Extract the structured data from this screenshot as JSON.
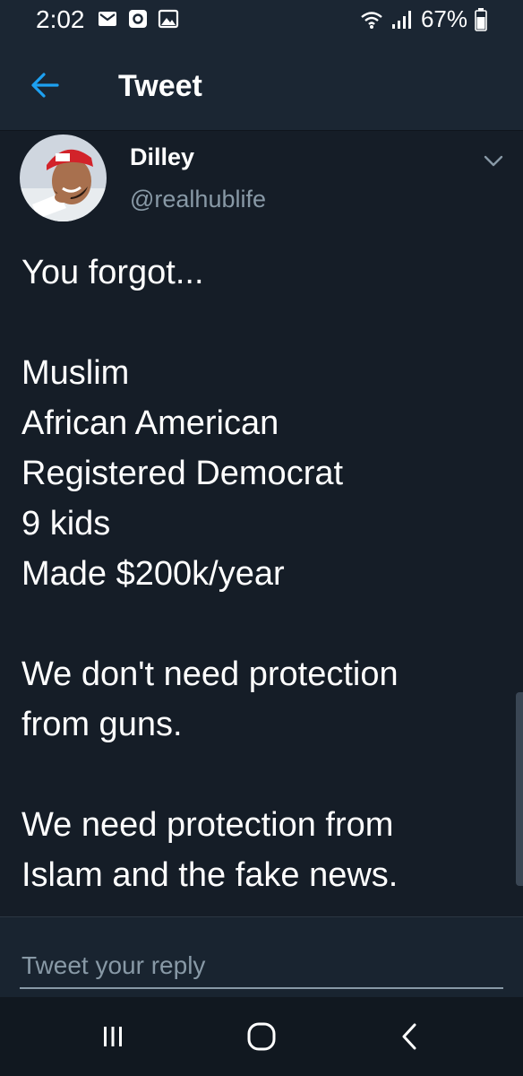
{
  "status_bar": {
    "time": "2:02",
    "notification_icons": [
      "mail-icon",
      "o-square-icon",
      "image-icon"
    ],
    "battery_percent": "67%",
    "right_icons": [
      "wifi-icon",
      "signal-icon",
      "battery-icon"
    ]
  },
  "header": {
    "back_icon": "arrow-left-icon",
    "title": "Tweet"
  },
  "tweet": {
    "author_name": "Dilley",
    "author_handle": "@realhublife",
    "menu_icon": "chevron-down-icon",
    "lines": [
      "You forgot...",
      "",
      "Muslim",
      "African American",
      "Registered Democrat",
      "9 kids",
      "Made $200k/year",
      "",
      "We don't need protection",
      "from guns.",
      "",
      "We need protection from",
      "Islam and the fake news."
    ]
  },
  "reply": {
    "placeholder": "Tweet your reply",
    "value": ""
  },
  "navigation_bar": {
    "buttons": [
      "recents-icon",
      "home-icon",
      "back-icon"
    ]
  },
  "colors": {
    "background": "#151d27",
    "bar": "#1b2633",
    "accent": "#1da1f2",
    "secondary_text": "#8899a6"
  }
}
